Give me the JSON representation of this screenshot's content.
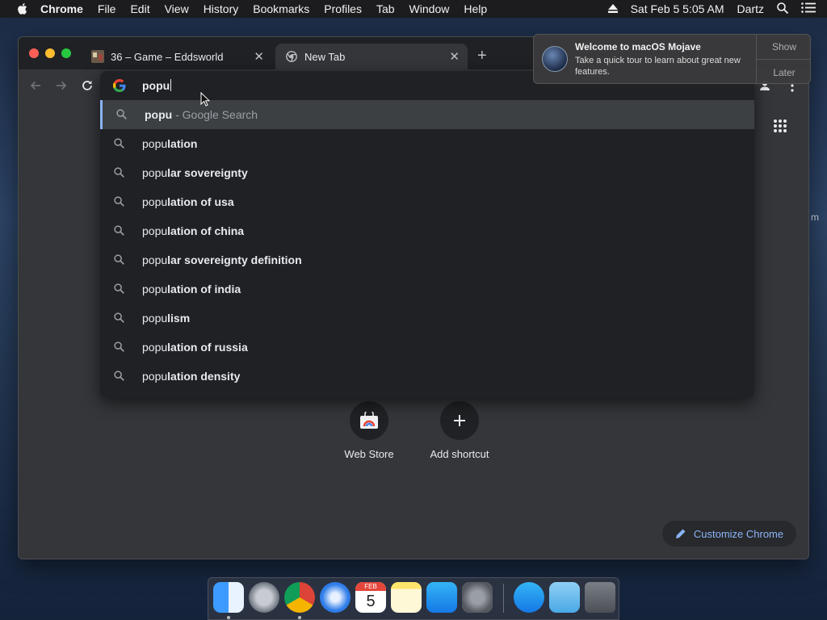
{
  "menubar": {
    "app": "Chrome",
    "items": [
      "File",
      "Edit",
      "View",
      "History",
      "Bookmarks",
      "Profiles",
      "Tab",
      "Window",
      "Help"
    ],
    "datetime": "Sat Feb 5  5:05 AM",
    "user": "Dartz"
  },
  "tabs": [
    {
      "title": "36 – Game – Eddsworld"
    },
    {
      "title": "New Tab"
    }
  ],
  "omnibox": {
    "typed": "popu",
    "suggestions": [
      {
        "typed": "popu",
        "rest": "",
        "suffix": " - Google Search"
      },
      {
        "typed": "popu",
        "rest": "lation",
        "suffix": ""
      },
      {
        "typed": "popu",
        "rest": "lar sovereignty",
        "suffix": ""
      },
      {
        "typed": "popu",
        "rest": "lation of usa",
        "suffix": ""
      },
      {
        "typed": "popu",
        "rest": "lation of china",
        "suffix": ""
      },
      {
        "typed": "popu",
        "rest": "lar sovereignty definition",
        "suffix": ""
      },
      {
        "typed": "popu",
        "rest": "lation of india",
        "suffix": ""
      },
      {
        "typed": "popu",
        "rest": "lism",
        "suffix": ""
      },
      {
        "typed": "popu",
        "rest": "lation of russia",
        "suffix": ""
      },
      {
        "typed": "popu",
        "rest": "lation density",
        "suffix": ""
      }
    ]
  },
  "shortcuts": [
    {
      "label": "Web Store"
    },
    {
      "label": "Add shortcut"
    }
  ],
  "customize_label": "Customize Chrome",
  "notification": {
    "title": "Welcome to macOS Mojave",
    "body": "Take a quick tour to learn about great new features.",
    "show": "Show",
    "later": "Later"
  },
  "dock": {
    "calendar_month": "FEB",
    "calendar_day": "5"
  },
  "colors": {
    "accent": "#8ab4f8",
    "window_bg": "#35363a",
    "tabstrip_bg": "#202124"
  }
}
